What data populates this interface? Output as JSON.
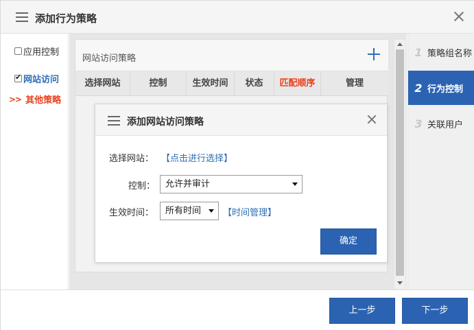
{
  "window": {
    "title": "添加行为策略"
  },
  "left_nav": {
    "items": [
      {
        "label": "应用控制",
        "checked": false
      },
      {
        "label": "网站访问",
        "checked": true
      },
      {
        "label": "其他策略",
        "prefix": ">>"
      }
    ]
  },
  "policy_panel": {
    "title": "网站访问策略",
    "columns": [
      "选择网站",
      "控制",
      "生效时间",
      "状态",
      "匹配顺序",
      "管理"
    ]
  },
  "popup": {
    "title": "添加网站访问策略",
    "select_site_label": "选择网站：",
    "select_site_link": "【点击进行选择】",
    "control_label": "控制：",
    "control_value": "允许并审计",
    "time_label": "生效时间：",
    "time_value": "所有时间",
    "time_manage_link": "【时间管理】",
    "confirm_button": "确定"
  },
  "steps": [
    {
      "num": "1",
      "label": "策略组名称"
    },
    {
      "num": "2",
      "label": "行为控制",
      "active": true
    },
    {
      "num": "3",
      "label": "关联用户"
    }
  ],
  "footer": {
    "prev_button": "上一步",
    "next_button": "下一步"
  },
  "colors": {
    "accent": "#2b63b2",
    "highlight_red": "#e8421e"
  }
}
